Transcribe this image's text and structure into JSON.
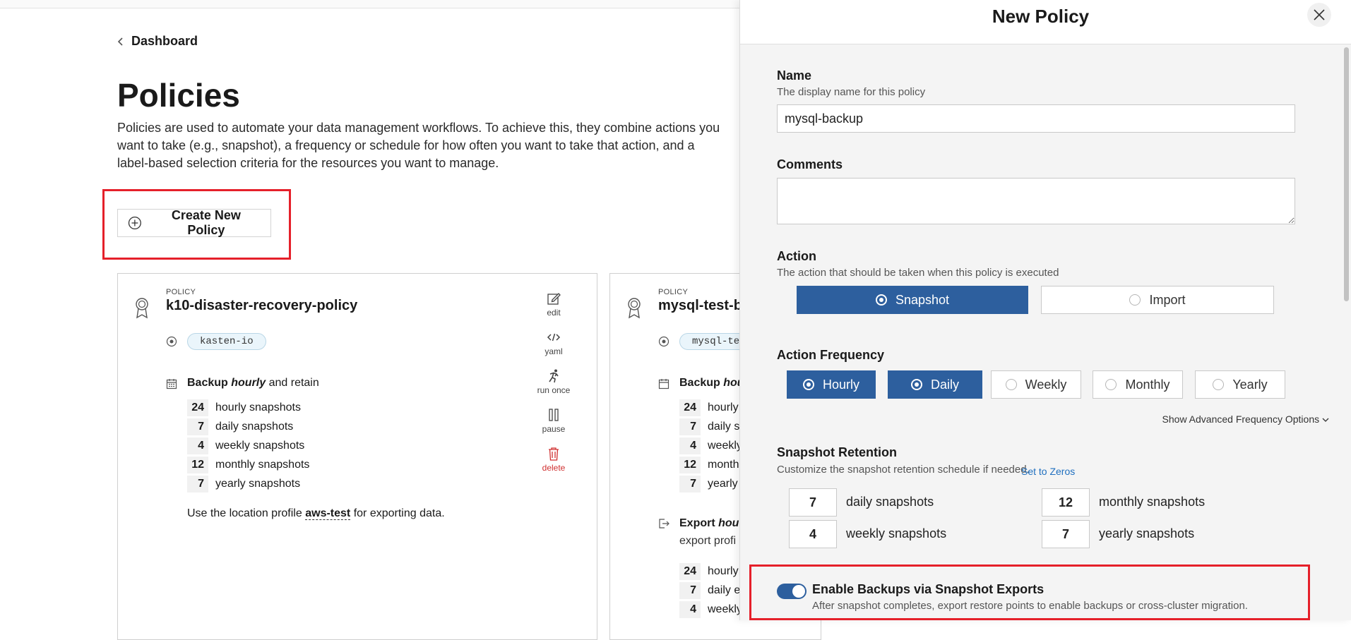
{
  "breadcrumb": {
    "label": "Dashboard"
  },
  "page": {
    "title": "Policies",
    "description": "Policies are used to automate your data management workflows. To achieve this, they combine actions you want to take (e.g., snapshot), a frequency or schedule for how often you want to take that action, and a label-based selection criteria for the resources you want to manage.",
    "create_button": "Create New Policy"
  },
  "cards": [
    {
      "kicker": "POLICY",
      "name": "k10-disaster-recovery-policy",
      "namespace": "kasten-io",
      "backup": {
        "prefix": "Backup",
        "frequency": "hourly",
        "suffix": "and retain"
      },
      "retention": [
        {
          "count": "24",
          "label": "hourly snapshots"
        },
        {
          "count": "7",
          "label": "daily snapshots"
        },
        {
          "count": "4",
          "label": "weekly snapshots"
        },
        {
          "count": "12",
          "label": "monthly snapshots"
        },
        {
          "count": "7",
          "label": "yearly snapshots"
        }
      ],
      "location": {
        "prefix": "Use the location profile",
        "profile": "aws-test",
        "suffix": "for exporting data."
      },
      "actions": [
        {
          "label": "edit",
          "icon": "edit-icon"
        },
        {
          "label": "yaml",
          "icon": "code-icon"
        },
        {
          "label": "run once",
          "icon": "run-icon"
        },
        {
          "label": "pause",
          "icon": "pause-icon"
        },
        {
          "label": "delete",
          "icon": "trash-icon"
        }
      ]
    },
    {
      "kicker": "POLICY",
      "name": "mysql-test-b",
      "namespace": "mysql-te",
      "backup": {
        "prefix": "Backup",
        "frequency": "hou"
      },
      "retention": [
        {
          "count": "24",
          "label": "hourly"
        },
        {
          "count": "7",
          "label": "daily s"
        },
        {
          "count": "4",
          "label": "weekly"
        },
        {
          "count": "12",
          "label": "month"
        },
        {
          "count": "7",
          "label": "yearly"
        }
      ],
      "export": {
        "prefix": "Export",
        "frequency": "hou",
        "sub": "export profi"
      },
      "export_retention": [
        {
          "count": "24",
          "label": "hourly"
        },
        {
          "count": "7",
          "label": "daily e"
        },
        {
          "count": "4",
          "label": "weekly"
        }
      ]
    }
  ],
  "panel": {
    "title": "New Policy",
    "name": {
      "label": "Name",
      "hint": "The display name for this policy",
      "value": "mysql-backup"
    },
    "comments": {
      "label": "Comments",
      "value": ""
    },
    "action": {
      "label": "Action",
      "hint": "The action that should be taken when this policy is executed",
      "options": [
        "Snapshot",
        "Import"
      ],
      "selected": "Snapshot"
    },
    "frequency": {
      "label": "Action Frequency",
      "options": [
        "Hourly",
        "Daily",
        "Weekly",
        "Monthly",
        "Yearly"
      ],
      "selected": "Daily",
      "advanced_link": "Show Advanced Frequency Options"
    },
    "retention": {
      "label": "Snapshot Retention",
      "hint": "Customize the snapshot retention schedule if needed.",
      "set_zeros": "Set to Zeros",
      "daily": {
        "value": "7",
        "label": "daily snapshots"
      },
      "weekly": {
        "value": "4",
        "label": "weekly snapshots"
      },
      "monthly": {
        "value": "12",
        "label": "monthly snapshots"
      },
      "yearly": {
        "value": "7",
        "label": "yearly snapshots"
      }
    },
    "exports": {
      "label": "Enable Backups via Snapshot Exports",
      "description": "After snapshot completes, export restore points to enable backups or cross-cluster migration.",
      "enabled": true
    }
  },
  "colors": {
    "accent": "#2d5f9e",
    "highlight": "#e5202a",
    "link": "#1f6fbf",
    "danger": "#d03030"
  }
}
